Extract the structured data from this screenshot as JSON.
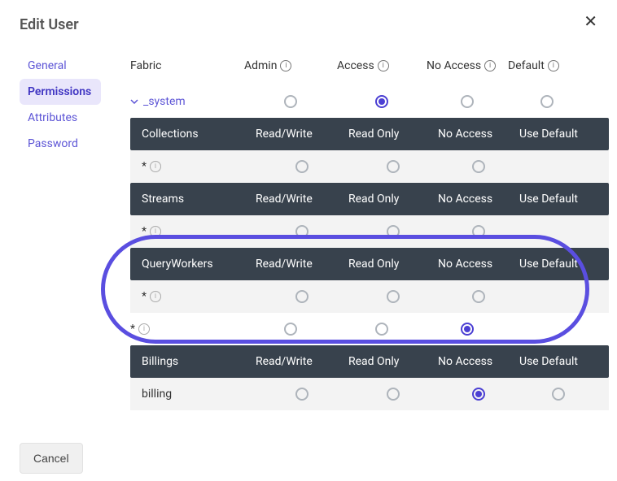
{
  "title": "Edit User",
  "sidebar": {
    "items": [
      {
        "label": "General"
      },
      {
        "label": "Permissions"
      },
      {
        "label": "Attributes"
      },
      {
        "label": "Password"
      }
    ],
    "active_index": 1
  },
  "header": {
    "col0": "Fabric",
    "col1": "Admin",
    "col2": "Access",
    "col3": "No Access",
    "col4": "Default"
  },
  "fabric_row": {
    "name": "_system",
    "selected_index": 1
  },
  "sections": [
    {
      "title": "Collections",
      "cols": [
        "Read/Write",
        "Read Only",
        "No Access",
        "Use Default"
      ],
      "rows": [
        {
          "label": "*",
          "info": true,
          "selected_index": -1
        }
      ]
    },
    {
      "title": "Streams",
      "cols": [
        "Read/Write",
        "Read Only",
        "No Access",
        "Use Default"
      ],
      "rows": [
        {
          "label": "*",
          "info": true,
          "selected_index": -1
        }
      ]
    },
    {
      "title": "QueryWorkers",
      "cols": [
        "Read/Write",
        "Read Only",
        "No Access",
        "Use Default"
      ],
      "rows": [
        {
          "label": "*",
          "info": true,
          "selected_index": -1
        }
      ]
    }
  ],
  "plain_row": {
    "label": "*",
    "info": true,
    "selected_index": 2
  },
  "billings_section": {
    "title": "Billings",
    "cols": [
      "Read/Write",
      "Read Only",
      "No Access",
      "Use Default"
    ],
    "rows": [
      {
        "label": "billing",
        "info": false,
        "selected_index": 2
      }
    ]
  },
  "cancel_label": "Cancel"
}
